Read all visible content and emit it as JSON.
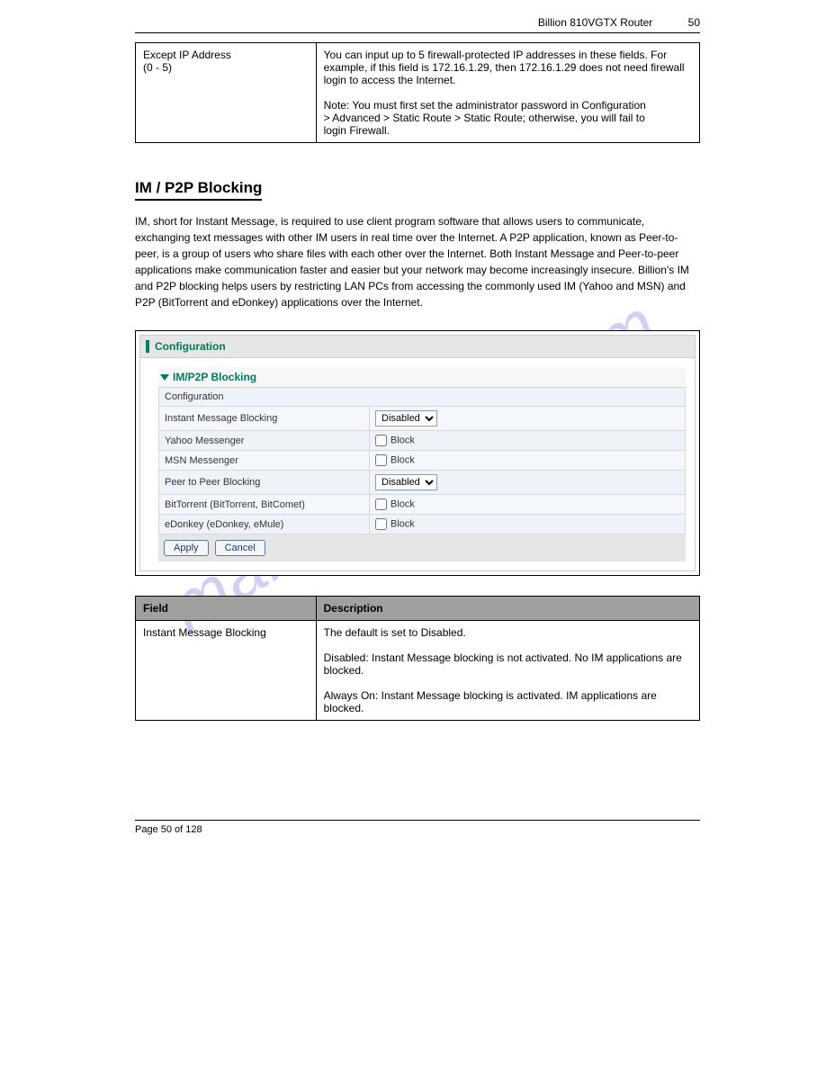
{
  "watermark": "manualshive.com",
  "header": {
    "title": "Billion 810VGTX Router",
    "page_no": "50"
  },
  "top_table": {
    "left": "Except IP Address\n (0 - 5)",
    "right": "You can input up to 5 firewall-protected IP addresses in these fields. For\nexample, if this field is 172.16.1.29, then 172.16.1.29 does not need firewall\nlogin to access the Internet.\n\nNote: You must first set the administrator password in Configuration\n> Advanced > Static Route > Static Route; otherwise, you will fail to\nlogin Firewall."
  },
  "section": {
    "title": "IM / P2P Blocking",
    "p1": "IM, short for Instant Message, is required to use client program software that allows users to communicate, exchanging text messages with other IM users in real time over the Internet.  A P2P application, known as Peer-to-peer, is a group of users who share files with each other over the Internet.  Both Instant Message and Peer-to-peer applications make communication faster and easier but your network may become increasingly insecure.  Billion's IM and P2P blocking helps users by restricting LAN PCs from accessing the commonly used IM (Yahoo and MSN) and P2P (BitTorrent and eDonkey) applications over the Internet."
  },
  "config": {
    "title": "Configuration",
    "sub": "IM/P2P Blocking",
    "config_row": "Configuration",
    "rows": {
      "im_block": {
        "label": "Instant Message Blocking",
        "value": "Disabled"
      },
      "yahoo": {
        "label": "Yahoo Messenger",
        "value": "Block"
      },
      "msn": {
        "label": "MSN Messenger",
        "value": "Block"
      },
      "p2p_block": {
        "label": "Peer to Peer Blocking",
        "value": "Disabled"
      },
      "bt": {
        "label": "BitTorrent (BitTorrent, BitComet)",
        "value": "Block"
      },
      "ed": {
        "label": "eDonkey (eDonkey, eMule)",
        "value": "Block"
      }
    },
    "buttons": {
      "apply": "Apply",
      "cancel": "Cancel"
    }
  },
  "bottom_table": {
    "h1": "Field",
    "h2": "Description",
    "r1l": "Instant Message Blocking",
    "r1r": "The default is set to Disabled.\n\nDisabled: Instant Message blocking is not activated. No IM applications are\nblocked.\n\nAlways On: Instant Message blocking is activated. IM applications are\nblocked."
  },
  "footer": {
    "text": "Page 50 of 128"
  }
}
